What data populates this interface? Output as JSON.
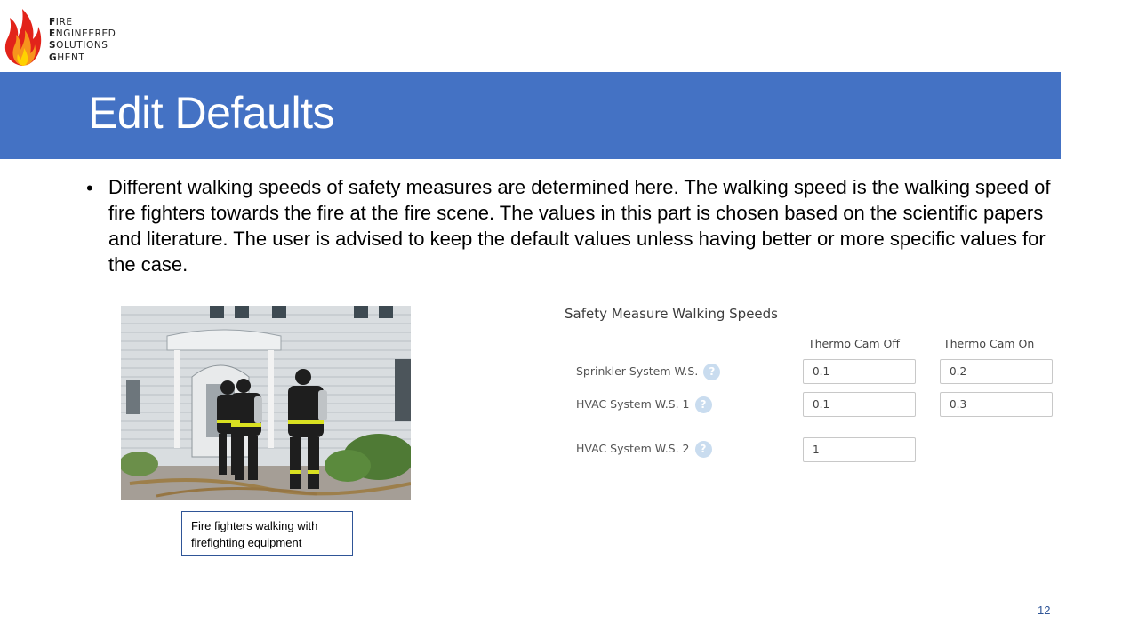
{
  "logo": {
    "lines": [
      {
        "initial": "F",
        "rest": "IRE"
      },
      {
        "initial": "E",
        "rest": "NGINEERED"
      },
      {
        "initial": "S",
        "rest": "OLUTIONS"
      },
      {
        "initial": "G",
        "rest": "HENT"
      }
    ]
  },
  "slide": {
    "title": "Edit Defaults",
    "bullet_mark": "•",
    "bullet_text": "Different walking speeds of safety measures are determined here. The walking speed is the walking speed of fire fighters towards the fire at the fire scene. The values in this part is chosen based on the scientific papers and literature. The user is advised to keep the default values unless having better or more specific values for the case.",
    "caption": "Fire fighters walking with firefighting equipment",
    "page_number": "12"
  },
  "form": {
    "title": "Safety Measure Walking Speeds",
    "columns": [
      "Thermo Cam Off",
      "Thermo Cam On"
    ],
    "help_glyph": "?",
    "rows": [
      {
        "label": "Sprinkler System W.S.",
        "values": [
          "0.1",
          "0.2"
        ]
      },
      {
        "label": "HVAC System W.S. 1",
        "values": [
          "0.1",
          "0.3"
        ]
      },
      {
        "label": "HVAC System W.S. 2",
        "values": [
          "1"
        ]
      }
    ]
  },
  "colors": {
    "title_band": "#4472c4",
    "caption_border": "#2f5597",
    "help_icon": "#c9dcef"
  },
  "icons": [
    "flame-logo-icon",
    "help-icon"
  ]
}
